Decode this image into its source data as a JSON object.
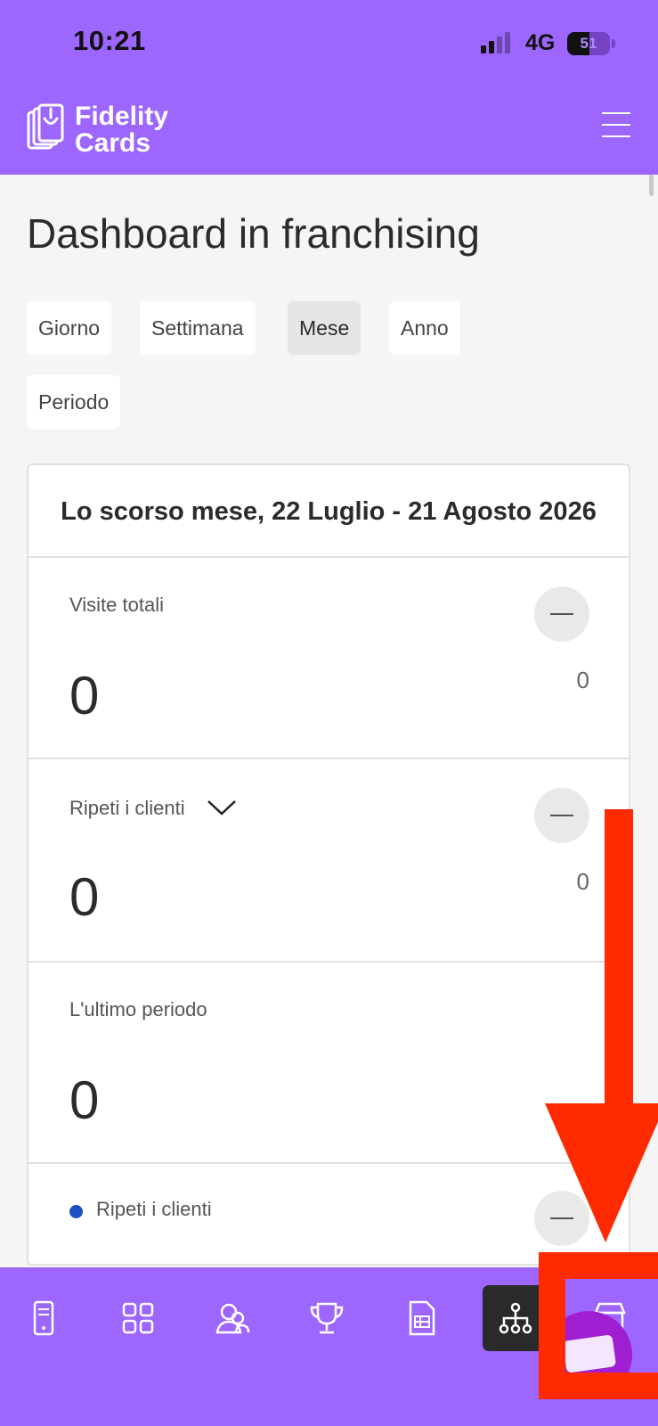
{
  "status_bar": {
    "time": "10:21",
    "network": "4G",
    "battery": "51"
  },
  "header": {
    "brand_line1": "Fidelity",
    "brand_line2": "Cards"
  },
  "page": {
    "title": "Dashboard in franchising"
  },
  "period_tabs": [
    "Giorno",
    "Settimana",
    "Mese",
    "Anno",
    "Periodo"
  ],
  "active_period": "Mese",
  "card": {
    "header": "Lo scorso mese, 22 Luglio - 21 Agosto 2026",
    "metrics": [
      {
        "label": "Visite totali",
        "value": "0",
        "compare": "0",
        "trend": "—"
      },
      {
        "label": "Ripeti i clienti",
        "value": "0",
        "compare": "0",
        "trend": "—"
      },
      {
        "label": "L'ultimo periodo",
        "value": "0"
      },
      {
        "label": "Ripeti i clienti",
        "trend": "—",
        "dot_color": "#1f4fc4"
      }
    ]
  },
  "bottom_nav": {
    "items": [
      "phone-icon",
      "grid-icon",
      "customers-icon",
      "trophy-icon",
      "document-icon",
      "hierarchy-icon",
      "store-icon"
    ],
    "active": "hierarchy-icon"
  },
  "colors": {
    "brand": "#9d66ff",
    "annotation": "#ff2a00",
    "fab": "#a01fd2"
  }
}
